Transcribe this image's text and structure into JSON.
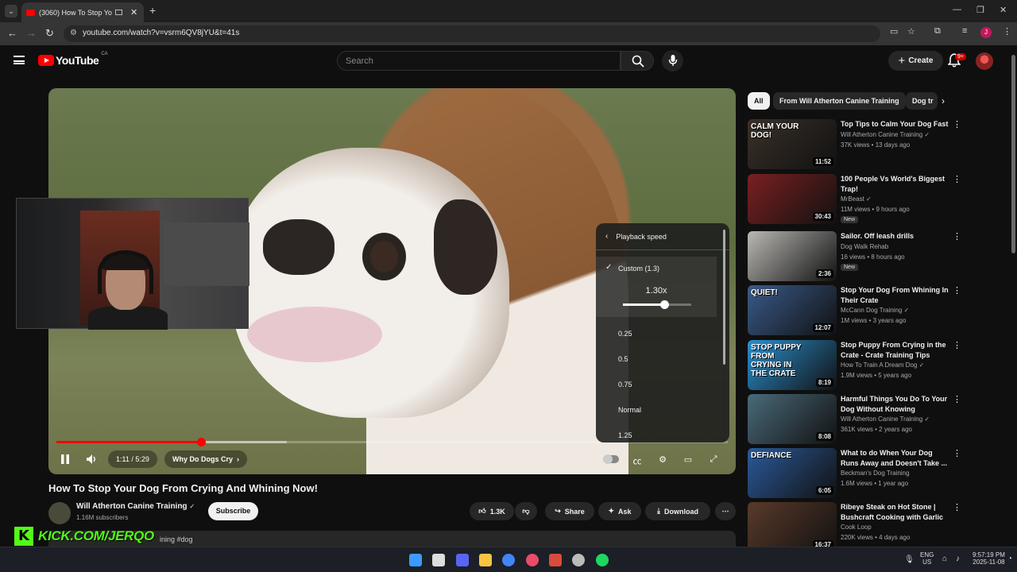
{
  "browser": {
    "tab_title": "(3060) How To Stop Your Do",
    "tab_close": "✕",
    "new_tab": "+",
    "url": "youtube.com/watch?v=vsrm6QV8jYU&t=41s",
    "profile_initial": "J",
    "window_controls": [
      "—",
      "❐",
      "✕"
    ]
  },
  "youtube": {
    "logo_text": "YouTube",
    "country": "CA",
    "search_placeholder": "Search",
    "create_label": "Create",
    "notification_badge": "9+"
  },
  "player": {
    "current_time": "1:11 / 5:29",
    "chapter": "Why Do Dogs Cry",
    "progress_fraction": 0.2158,
    "buffered_fraction": 0.343,
    "speed_menu": {
      "title": "Playback speed",
      "custom_label": "Custom (1.3)",
      "custom_value": "1.30x",
      "slider_fraction": 0.6,
      "options": [
        "0.25",
        "0.5",
        "0.75",
        "Normal",
        "1.25"
      ]
    }
  },
  "video": {
    "title": "How To Stop Your Dog From Crying And Whining Now!",
    "channel": "Will Atherton Canine Training",
    "verified": "✓",
    "subscribers": "1.16M subscribers",
    "subscribe_label": "Subscribe",
    "likes": "1.3K",
    "share_label": "Share",
    "ask_label": "Ask",
    "download_label": "Download",
    "description_snippet": "ining #dog"
  },
  "overlay": {
    "kick_logo": "K",
    "kick_text": "KICK.COM/JERQO"
  },
  "sidebar": {
    "chips": [
      "All",
      "From Will Atherton Canine Training",
      "Dog tr"
    ],
    "recommendations": [
      {
        "title": "Top Tips to Calm Your Dog Fast",
        "channel": "Will Atherton Canine Training",
        "verified": true,
        "meta": "37K views • 13 days ago",
        "duration": "11:52",
        "new": "",
        "thumb_text": "CALM YOUR DOG!",
        "thumb_color": "#3a3028"
      },
      {
        "title": "100 People Vs World's Biggest Trap!",
        "channel": "MrBeast",
        "verified": true,
        "meta": "11M views • 9 hours ago",
        "duration": "30:43",
        "new": "New",
        "thumb_text": "",
        "thumb_color": "#7a2020"
      },
      {
        "title": "Sailor. Off leash drills",
        "channel": "Dog Walk Rehab",
        "verified": false,
        "meta": "16 views • 8 hours ago",
        "duration": "2:36",
        "new": "New",
        "thumb_text": "",
        "thumb_color": "#b9b8b4"
      },
      {
        "title": "Stop Your Dog From Whining In Their Crate",
        "channel": "McCann Dog Training",
        "verified": true,
        "meta": "1M views • 3 years ago",
        "duration": "12:07",
        "new": "",
        "thumb_text": "QUIET!",
        "thumb_color": "#3a5a8a"
      },
      {
        "title": "Stop Puppy From Crying in the Crate - Crate Training Tips",
        "channel": "How To Train A Dream Dog",
        "verified": true,
        "meta": "1.9M views • 5 years ago",
        "duration": "8:19",
        "new": "",
        "thumb_text": "STOP PUPPY FROM CRYING IN THE CRATE",
        "thumb_color": "#2a8fcf"
      },
      {
        "title": "Harmful Things You Do To Your Dog Without Knowing",
        "channel": "Will Atherton Canine Training",
        "verified": true,
        "meta": "361K views • 2 years ago",
        "duration": "8:08",
        "new": "",
        "thumb_text": "",
        "thumb_color": "#4a6a7a"
      },
      {
        "title": "What to do When Your Dog Runs Away and Doesn't Take ...",
        "channel": "Beckman's Dog Training",
        "verified": false,
        "meta": "1.6M views • 1 year ago",
        "duration": "6:05",
        "new": "",
        "thumb_text": "DEFIANCE",
        "thumb_color": "#2a5a9a"
      },
      {
        "title": "Ribeye Steak on Hot Stone | Bushcraft Cooking with Garlic ...",
        "channel": "Cook Loop",
        "verified": false,
        "meta": "220K views • 4 days ago",
        "duration": "16:37",
        "new": "",
        "thumb_text": "",
        "thumb_color": "#5a3a2a"
      }
    ]
  },
  "taskbar": {
    "lang": "ENG",
    "region": "US",
    "time": "9:57:19 PM",
    "date": "2025-11-08",
    "icon_colors": [
      "#3b9bff",
      "#dddddd",
      "#5865f2",
      "#f5c542",
      "#4285f4",
      "#e94b6a",
      "#d94c3d",
      "#bbbbbb",
      "#1ed760"
    ]
  }
}
